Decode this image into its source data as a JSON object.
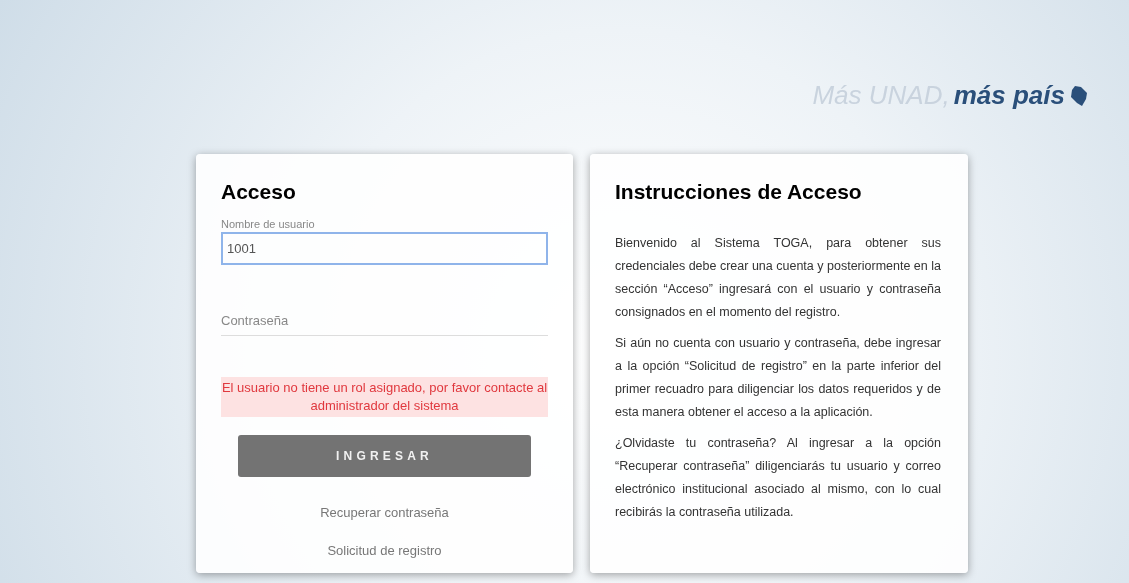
{
  "slogan": {
    "faded": "Más UNAD,",
    "bold": "más país"
  },
  "login": {
    "title": "Acceso",
    "username": {
      "label": "Nombre de usuario",
      "value": "1001",
      "focused": true
    },
    "password": {
      "placeholder": "Contraseña"
    },
    "error": "El usuario no tiene un rol asignado, por favor contacte al administrador del sistema",
    "submit": "INGRESAR",
    "links": [
      "Recuperar contraseña",
      "Solicitud de registro"
    ]
  },
  "instructions": {
    "title": "Instrucciones de Acceso",
    "paragraphs": [
      "Bienvenido al Sistema TOGA, para obtener sus credenciales debe crear una cuenta y posteriormente en la sección “Acceso” ingresará con el usuario y contraseña consignados en el momento del registro.",
      "Si aún no cuenta con usuario y contraseña, debe ingresar a la opción “Solicitud de registro” en la parte inferior del primer recuadro para diligenciar los datos requeridos y de esta manera obtener el acceso a la aplicación.",
      "¿Olvidaste tu contraseña? Al ingresar a la opción “Recuperar contraseña” diligenciarás tu usuario y correo electrónico institucional asociado al mismo, con lo cual recibirás la contraseña utilizada."
    ]
  }
}
